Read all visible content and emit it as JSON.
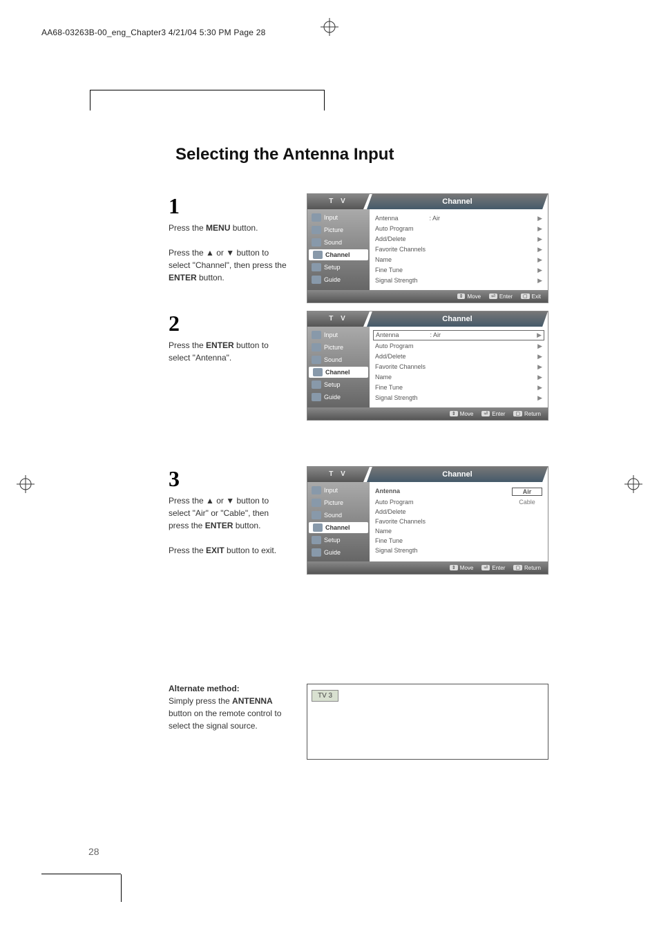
{
  "header": "AA68-03263B-00_eng_Chapter3  4/21/04  5:30 PM  Page 28",
  "title": "Selecting the Antenna Input",
  "steps": {
    "s1": {
      "num": "1",
      "p1a": "Press the ",
      "p1b": "MENU",
      "p1c": " button.",
      "p2a": "Press the ▲ or ▼ button to select \"Channel\", then press the ",
      "p2b": "ENTER",
      "p2c": " button."
    },
    "s2": {
      "num": "2",
      "p1a": "Press the ",
      "p1b": "ENTER",
      "p1c": " button to select \"Antenna\"."
    },
    "s3": {
      "num": "3",
      "p1a": "Press the ▲ or ▼ button to select \"Air\" or \"Cable\", then press the ",
      "p1b": "ENTER",
      "p1c": "     button.",
      "p2a": "Press the ",
      "p2b": "EXIT",
      "p2c": " button to exit."
    },
    "alt": {
      "title": "Alternate method:",
      "p1a": "Simply press the ",
      "p1b": "ANTENNA",
      "p1c": " button on the remote control to select the signal source.",
      "tab": "TV 3"
    }
  },
  "osd": {
    "tv": "T V",
    "channel": "Channel",
    "nav": {
      "input": "Input",
      "picture": "Picture",
      "sound": "Sound",
      "channel": "Channel",
      "setup": "Setup",
      "guide": "Guide"
    },
    "rows": {
      "antenna": "Antenna",
      "antenna_val": ": Air",
      "auto": "Auto Program",
      "add": "Add/Delete",
      "fav": "Favorite Channels",
      "name": "Name",
      "fine": "Fine Tune",
      "signal": "Signal Strength"
    },
    "opts": {
      "air": "Air",
      "cable": "Cable"
    },
    "footer": {
      "move": "Move",
      "enter": "Enter",
      "exit": "Exit",
      "return": "Return"
    }
  },
  "page_num": "28"
}
